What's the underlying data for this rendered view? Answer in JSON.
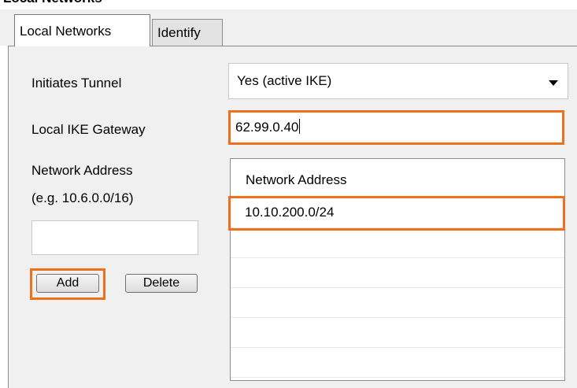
{
  "window": {
    "title": "Local Networks"
  },
  "tabs": [
    {
      "label": "Local Networks",
      "active": true
    },
    {
      "label": "Identify",
      "active": false
    }
  ],
  "form": {
    "initiates_tunnel_label": "Initiates Tunnel",
    "initiates_tunnel_value": "Yes (active IKE)",
    "local_ike_gateway_label": "Local IKE Gateway",
    "local_ike_gateway_value": "62.99.0.40",
    "network_address_label": "Network Address",
    "network_address_hint": "(e.g. 10.6.0.0/16)",
    "network_address_input_value": "",
    "add_label": "Add",
    "delete_label": "Delete"
  },
  "list": {
    "header": "Network Address",
    "rows": [
      "10.10.200.0/24",
      "",
      "",
      "",
      "",
      ""
    ]
  },
  "colors": {
    "highlight": "#ee6f1c",
    "panel_bg": "#f0f0f0"
  },
  "icons": {
    "dropdown": "chevron-down-icon"
  }
}
